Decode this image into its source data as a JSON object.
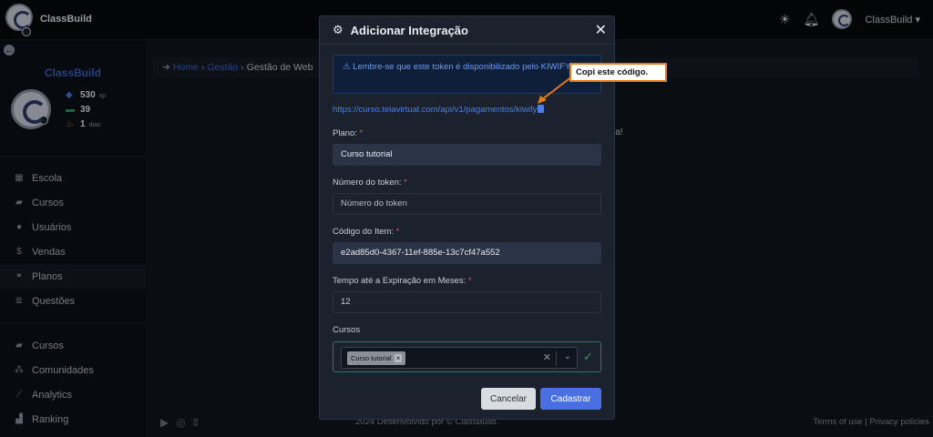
{
  "app": {
    "brand": "ClassBuild",
    "user_name": "ClassBuild"
  },
  "sidebar": {
    "brand": "ClassBuild",
    "stats": [
      {
        "icon": "diamond-icon",
        "value": "530",
        "unit": "xp",
        "color": "#3d7be0"
      },
      {
        "icon": "money-icon",
        "value": "39",
        "unit": "",
        "color": "#2e9c5c"
      },
      {
        "icon": "flame-icon",
        "value": "1",
        "unit": "dias",
        "color": "#e8761a"
      }
    ],
    "group1": [
      {
        "label": "Escola",
        "icon": "building-icon"
      },
      {
        "label": "Cursos",
        "icon": "graduation-cap-icon"
      },
      {
        "label": "Usuários",
        "icon": "users-icon"
      },
      {
        "label": "Vendas",
        "icon": "dollar-icon"
      },
      {
        "label": "Planos",
        "icon": "plans-icon"
      },
      {
        "label": "Questões",
        "icon": "database-icon"
      }
    ],
    "group2": [
      {
        "label": "Cursos",
        "icon": "graduation-cap-icon"
      },
      {
        "label": "Comunidades",
        "icon": "community-icon"
      },
      {
        "label": "Analytics",
        "icon": "chart-icon"
      },
      {
        "label": "Ranking",
        "icon": "ranking-icon"
      }
    ]
  },
  "breadcrumb": {
    "home": "Home",
    "gestao": "Gestão",
    "current": "Gestão de Web"
  },
  "background_text": "trada!",
  "footer": {
    "copy": "2024 Desenvolvido por © ClassBuild.",
    "links": "Terms of use | Privacy policies"
  },
  "modal": {
    "title": "Adicionar Integração",
    "alert": "Lembre-se que este token é disponibilizado pelo KIWIFY.",
    "link": "https://curso.teiavirtual.com/api/v1/pagamentos/kiwify",
    "plano_label": "Plano:",
    "plano_value": "Curso tutorial",
    "token_label": "Número do token:",
    "token_placeholder": "Número do token",
    "item_label": "Código do Item:",
    "item_value": "e2ad85d0-4367-11ef-885e-13c7cf47a552",
    "tempo_label": "Tempo até a Expiração em Meses:",
    "tempo_value": "12",
    "cursos_label": "Cursos",
    "cursos_chip": "Curso tutorial",
    "cancel": "Cancelar",
    "submit": "Cadastrar"
  },
  "callout": "Copi este código."
}
